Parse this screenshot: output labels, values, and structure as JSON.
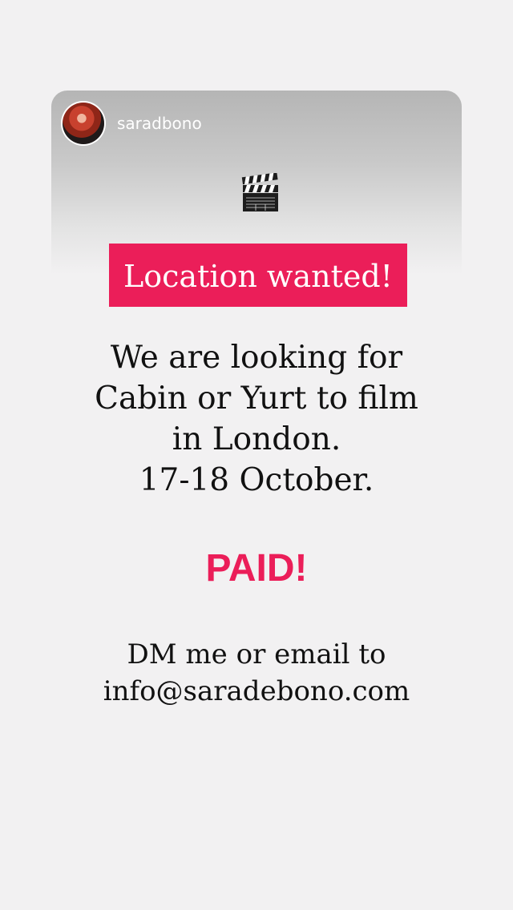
{
  "story": {
    "username": "saradbono",
    "avatar_icon": "profile-photo",
    "sticker_icon": "clapperboard-icon",
    "headline": "Location wanted!",
    "message_lines": [
      "We are looking for",
      "Cabin or Yurt to film",
      "in London.",
      "17-18 October."
    ],
    "callout": "PAID!",
    "contact_lines": [
      "DM me or email to",
      "info@saradebono.com"
    ]
  },
  "colors": {
    "accent": "#eb1e59",
    "text": "#111111",
    "background": "#f2f1f2",
    "header_gray": "#b5b5b5"
  }
}
